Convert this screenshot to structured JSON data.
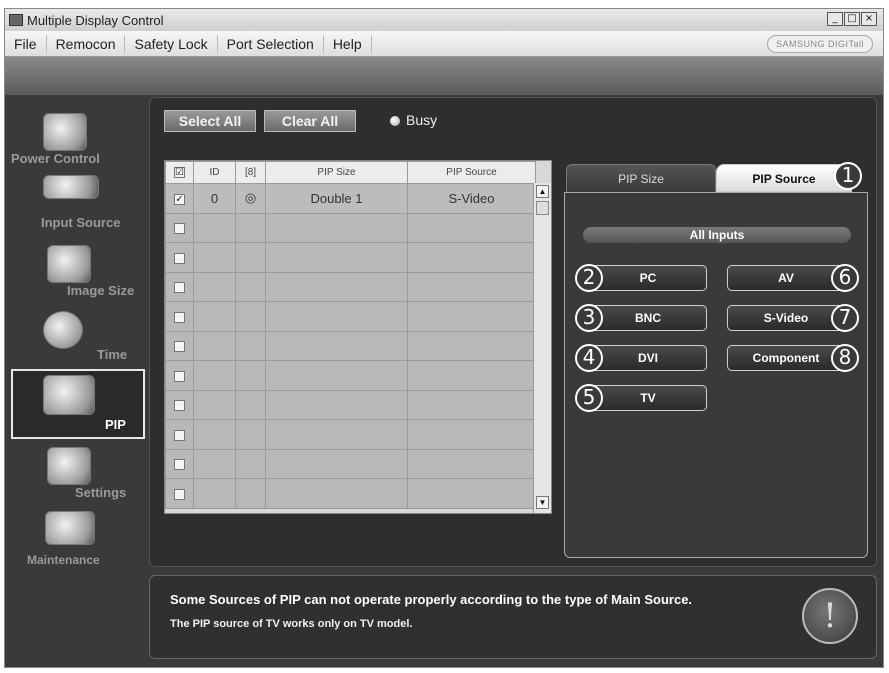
{
  "window": {
    "title": "Multiple Display Control",
    "minimize_glyph": "_",
    "maximize_glyph": "□",
    "close_glyph": "×"
  },
  "menu": {
    "items": [
      "File",
      "Remocon",
      "Safety Lock",
      "Port Selection",
      "Help"
    ],
    "brand": "SAMSUNG DIGITall"
  },
  "sidebar": {
    "items": [
      {
        "label": "Power Control",
        "icon": "power-control-icon"
      },
      {
        "label": "Input Source",
        "icon": "input-source-icon"
      },
      {
        "label": "Image Size",
        "icon": "image-size-icon"
      },
      {
        "label": "Time",
        "icon": "clock-icon"
      },
      {
        "label": "PIP",
        "icon": "pip-icon",
        "active": true
      },
      {
        "label": "Settings",
        "icon": "settings-icon"
      },
      {
        "label": "Maintenance",
        "icon": "maintenance-icon"
      }
    ]
  },
  "toolbar": {
    "select_all": "Select All",
    "clear_all": "Clear All",
    "busy_label": "Busy"
  },
  "grid": {
    "headers": {
      "check": "☑",
      "id": "ID",
      "status": "[8]",
      "pip_size": "PIP Size",
      "pip_source": "PIP Source"
    },
    "rows": [
      {
        "checked": true,
        "id": "0",
        "status": "◎",
        "pip_size": "Double 1",
        "pip_source": "S-Video"
      }
    ],
    "empty_row_count": 10,
    "scroll_up": "▲",
    "scroll_down": "▼"
  },
  "tabs": {
    "pip_size": "PIP Size",
    "pip_source": "PIP Source"
  },
  "pip_source_panel": {
    "group_label": "All Inputs",
    "buttons": {
      "pc": "PC",
      "av": "AV",
      "bnc": "BNC",
      "svideo": "S-Video",
      "dvi": "DVI",
      "component": "Component",
      "tv": "TV"
    }
  },
  "callouts": [
    "1",
    "2",
    "3",
    "4",
    "5",
    "6",
    "7",
    "8"
  ],
  "info": {
    "line1": "Some Sources of PIP can not operate properly according to the type of Main Source.",
    "line2": "The PIP source of TV works only on TV model.",
    "icon_glyph": "!"
  },
  "colors": {
    "panel_bg": "#2e2e2e",
    "button_border": "#d0d0d0",
    "active_tab_bg": "#ffffff"
  }
}
